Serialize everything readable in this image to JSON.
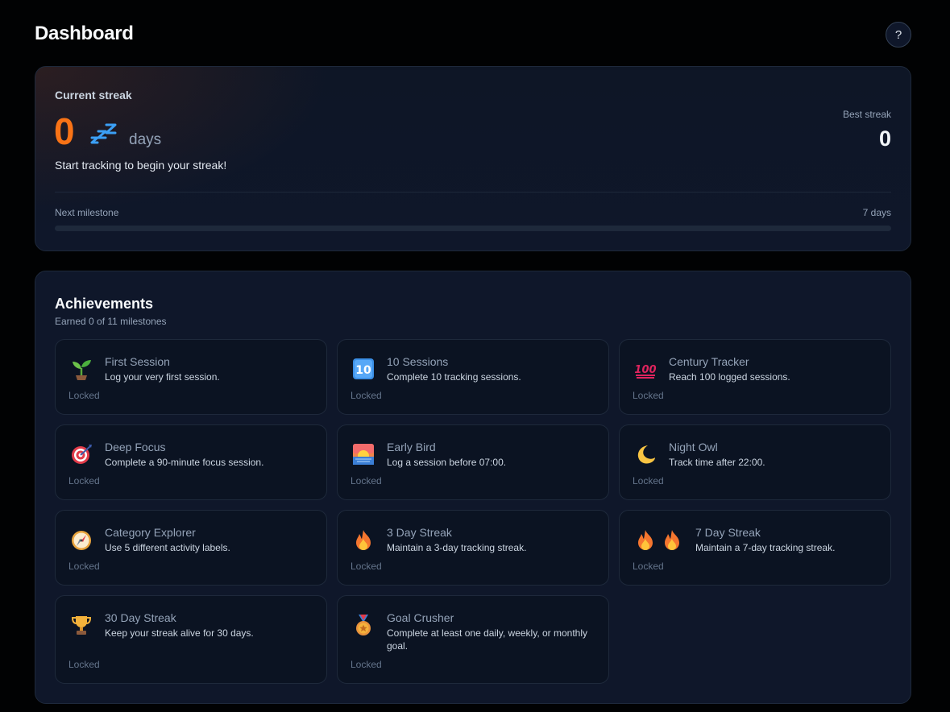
{
  "header": {
    "title": "Dashboard",
    "help_label": "?"
  },
  "streak": {
    "label": "Current streak",
    "value": "0",
    "unit": "days",
    "icon": "sleeping-zzz-icon",
    "message": "Start tracking to begin your streak!",
    "best_label": "Best streak",
    "best_value": "0",
    "milestone_label": "Next milestone",
    "milestone_value": "7 days",
    "milestone_progress": 0
  },
  "achievements": {
    "title": "Achievements",
    "subtitle": "Earned 0 of 11 milestones",
    "items": [
      {
        "name": "First Session",
        "desc": "Log your very first session.",
        "status": "Locked",
        "icon": "seedling-icon"
      },
      {
        "name": "10 Sessions",
        "desc": "Complete 10 tracking sessions.",
        "status": "Locked",
        "icon": "keycap-ten-icon"
      },
      {
        "name": "Century Tracker",
        "desc": "Reach 100 logged sessions.",
        "status": "Locked",
        "icon": "hundred-points-icon"
      },
      {
        "name": "Deep Focus",
        "desc": "Complete a 90-minute focus session.",
        "status": "Locked",
        "icon": "target-icon"
      },
      {
        "name": "Early Bird",
        "desc": "Log a session before 07:00.",
        "status": "Locked",
        "icon": "sunrise-icon"
      },
      {
        "name": "Night Owl",
        "desc": "Track time after 22:00.",
        "status": "Locked",
        "icon": "crescent-moon-icon"
      },
      {
        "name": "Category Explorer",
        "desc": "Use 5 different activity labels.",
        "status": "Locked",
        "icon": "compass-icon"
      },
      {
        "name": "3 Day Streak",
        "desc": "Maintain a 3-day tracking streak.",
        "status": "Locked",
        "icon": "fire-icon"
      },
      {
        "name": "7 Day Streak",
        "desc": "Maintain a 7-day tracking streak.",
        "status": "Locked",
        "icon": "double-fire-icon"
      },
      {
        "name": "30 Day Streak",
        "desc": "Keep your streak alive for 30 days.",
        "status": "Locked",
        "icon": "trophy-icon"
      },
      {
        "name": "Goal Crusher",
        "desc": "Complete at least one daily, weekly, or monthly goal.",
        "status": "Locked",
        "icon": "medal-icon"
      }
    ]
  },
  "colors": {
    "accent": "#f97316",
    "background": "#010203",
    "card": "#0f172a",
    "border": "#1e293b"
  }
}
